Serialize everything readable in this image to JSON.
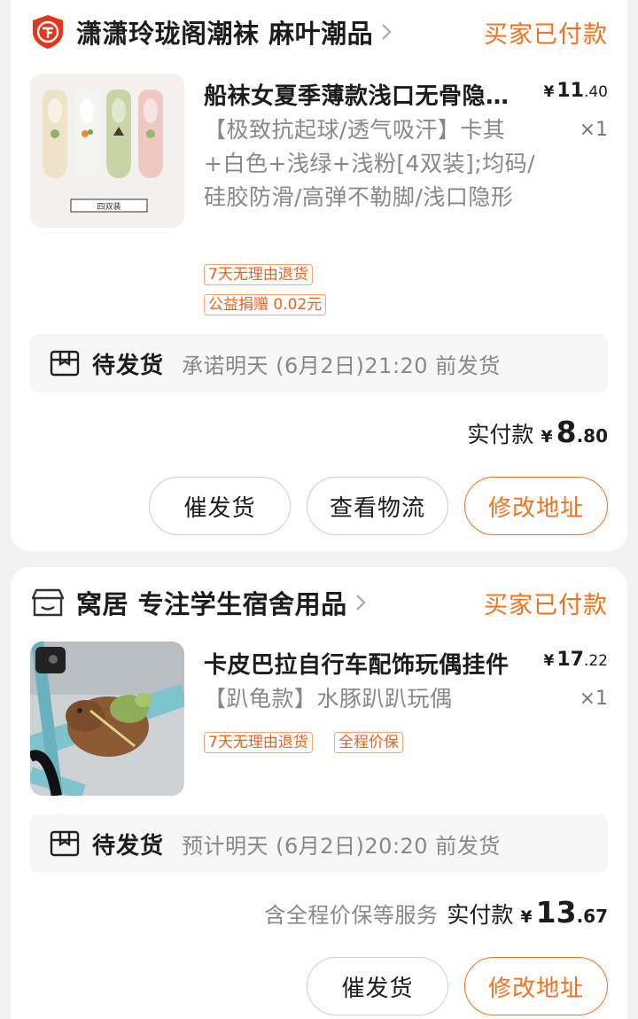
{
  "orders": [
    {
      "shop": {
        "name": "潇潇玲珑阁潮袜 麻叶潮品",
        "icon": "shield-qi-icon",
        "status": "买家已付款"
      },
      "item": {
        "title": "船袜女夏季薄款浅口无骨隐形袜",
        "thumb_caption": "四双装",
        "price_currency": "¥",
        "price_int": "11",
        "price_dec": ".40",
        "qty": "×1",
        "spec": "【极致抗起球/透气吸汗】卡其+白色+浅绿+浅粉[4双装];均码/硅胶防滑/高弹不勒脚/浅口隐形",
        "tags": [
          "7天无理由退货",
          "公益捐赠 0.02元"
        ]
      },
      "shipping": {
        "label": "待发货",
        "eta": "承诺明天 (6月2日)21:20 前发货"
      },
      "payment": {
        "note": "",
        "label": "实付款",
        "currency": "¥",
        "int": "8",
        "dec": ".80"
      },
      "buttons": [
        "催发货",
        "查看物流",
        "修改地址"
      ]
    },
    {
      "shop": {
        "name": "窝居 专注学生宿舍用品",
        "icon": "store-icon",
        "status": "买家已付款"
      },
      "item": {
        "title": "卡皮巴拉自行车配饰玩偶挂件",
        "price_currency": "¥",
        "price_int": "17",
        "price_dec": ".22",
        "qty": "×1",
        "spec": "【趴龟款】水豚趴趴玩偶",
        "tags": [
          "7天无理由退货",
          "全程价保"
        ]
      },
      "shipping": {
        "label": "待发货",
        "eta": "预计明天 (6月2日)20:20 前发货"
      },
      "payment": {
        "note": "含全程价保等服务",
        "label": "实付款",
        "currency": "¥",
        "int": "13",
        "dec": ".67"
      },
      "buttons": [
        "催发货",
        "修改地址"
      ]
    }
  ],
  "colors": {
    "accent": "#f4721f",
    "shield_red": "#e8341c",
    "muted_text": "#888888",
    "background": "#f2f2f2"
  }
}
